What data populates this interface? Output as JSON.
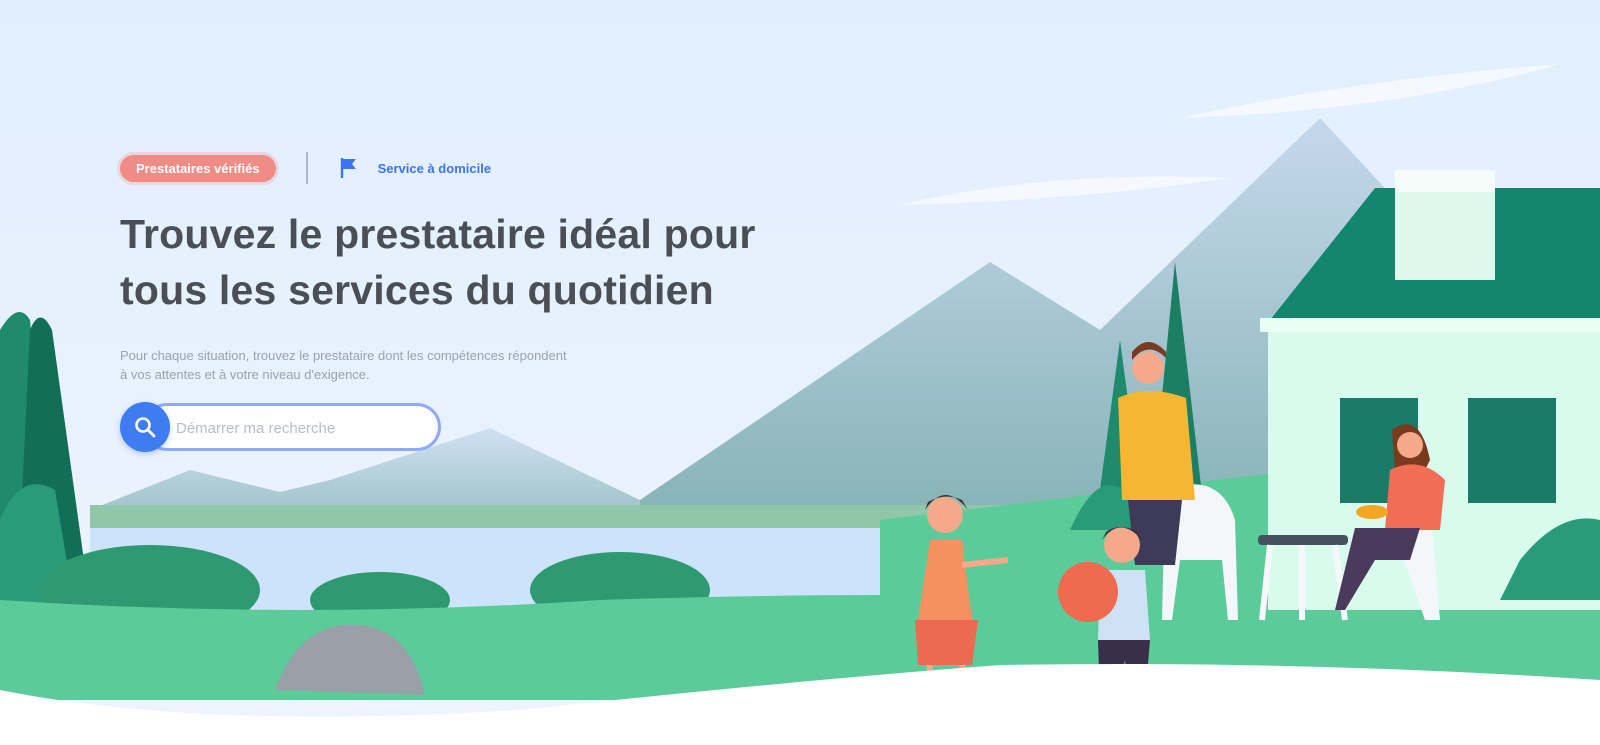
{
  "hero": {
    "badge": "Prestataires vérifiés",
    "service_chip": "Service à domicile",
    "title_line1": "Trouvez le prestataire idéal pour",
    "title_line2": "tous les services du quotidien",
    "description_line1": "Pour chaque situation, trouvez le prestataire dont les compétences répondent",
    "description_line2": "à vos attentes et à votre niveau d'exigence."
  },
  "search": {
    "placeholder": "Démarrer ma recherche",
    "icon": "search-icon"
  },
  "colors": {
    "accent_blue": "#3f7cf2",
    "badge_red": "#f08b86",
    "grass_green": "#5ccb9a",
    "house_roof": "#13866e",
    "sky": "#e3f0fe"
  }
}
